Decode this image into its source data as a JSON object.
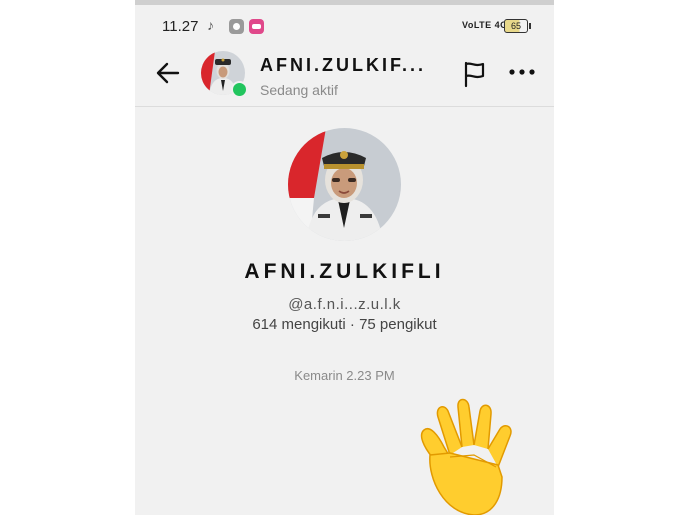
{
  "status_bar": {
    "time": "11.27",
    "network": "VoLTE 4G",
    "battery": "65"
  },
  "header": {
    "name": "AFNI.ZULKIF...",
    "status": "Sedang aktif"
  },
  "profile": {
    "name": "AFNI.ZULKIFLI",
    "handle": "@a.f.n.i...z.u.l.k",
    "stats": "614 mengikuti · 75 pengikut"
  },
  "chat": {
    "timestamp": "Kemarin 2.23 PM"
  },
  "colors": {
    "online": "#22c55e",
    "background": "#f1f1f1"
  },
  "icons": [
    "back-arrow-icon",
    "flag-icon",
    "more-dots-icon",
    "wave-hand-emoji"
  ]
}
